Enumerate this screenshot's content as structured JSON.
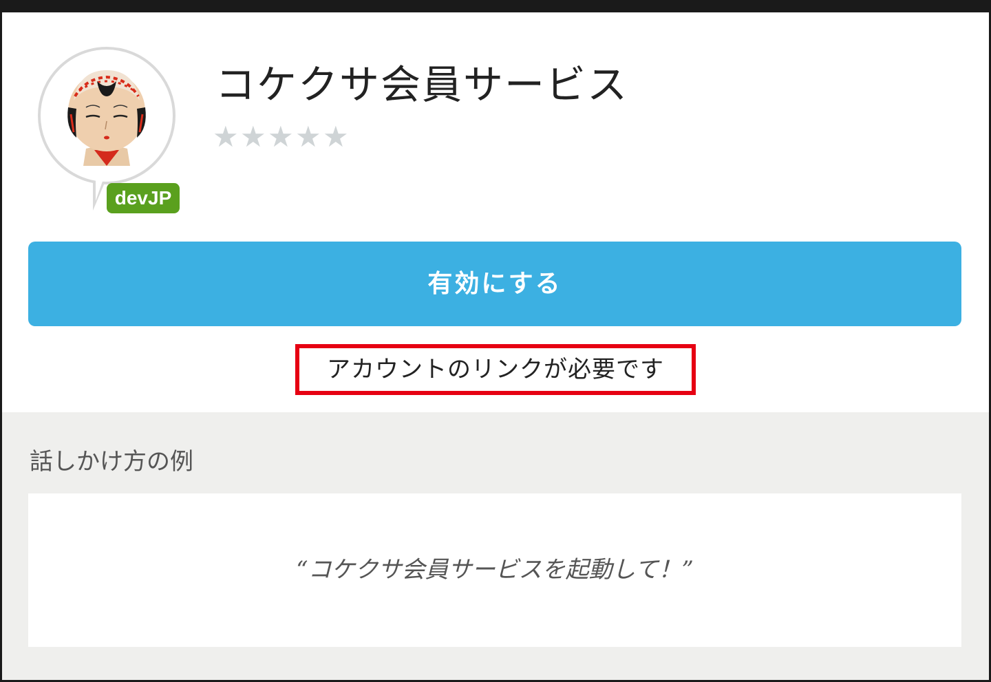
{
  "skill": {
    "title": "コケクサ会員サービス",
    "rating_stars": [
      "★",
      "★",
      "★",
      "★",
      "★"
    ],
    "rating_value": 0,
    "badge": "devJP",
    "icon": "kokeshi-doll-avatar"
  },
  "actions": {
    "enable_label": "有効にする",
    "account_link_notice": "アカウントのリンクが必要です"
  },
  "examples": {
    "heading": "話しかけ方の例",
    "items": [
      "“コケクサ会員サービスを起動して！”"
    ]
  },
  "colors": {
    "enable_button": "#3cb0e2",
    "badge": "#5aa01e",
    "highlight_border": "#e60012",
    "examples_background": "#efefed",
    "star_empty": "#cfd4d6"
  }
}
